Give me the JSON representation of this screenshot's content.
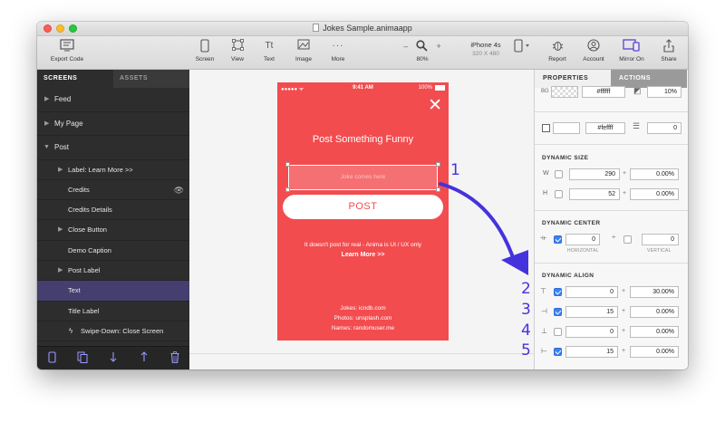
{
  "window": {
    "title": "Jokes Sample.animaapp"
  },
  "toolbar": {
    "export_label": "Export Code",
    "screen_label": "Screen",
    "view_label": "View",
    "text_label": "Text",
    "image_label": "Image",
    "more_label": "More",
    "zoom_value": "80%",
    "device_name": "iPhone 4s",
    "device_size": "320 X 480",
    "report_label": "Report",
    "account_label": "Account",
    "mirror_label": "Mirror On",
    "share_label": "Share",
    "text_icon_glyph": "Tt",
    "more_icon_glyph": "···",
    "zoom_out_glyph": "–",
    "zoom_in_glyph": "+",
    "accent_color": "#5b3fd6"
  },
  "sidebar": {
    "tab_screens": "SCREENS",
    "tab_assets": "ASSETS",
    "items": [
      {
        "label": "Feed"
      },
      {
        "label": "My Page"
      },
      {
        "label": "Post"
      },
      {
        "label": "Label: Learn More >>"
      },
      {
        "label": "Credits"
      },
      {
        "label": "Credits Details"
      },
      {
        "label": "Close Button"
      },
      {
        "label": "Demo Caption"
      },
      {
        "label": "Post Label"
      },
      {
        "label": "Text"
      },
      {
        "label": "Title Label"
      },
      {
        "label": "Swipe-Down: Close Screen"
      }
    ]
  },
  "phone": {
    "bg_color": "#f24c4f",
    "status_time": "9:41 AM",
    "status_battery": "100%",
    "status_signal": "●●●●● ᯤ",
    "title": "Post Something Funny",
    "joke_placeholder": "Joke comes here",
    "post_button": "POST",
    "note": "It doesn't post for real - Anima is UI / UX only",
    "learn_more": "Learn More >>",
    "credit_1": "Jokes: icndb.com",
    "credit_2": "Photos: unsplash.com",
    "credit_3": "Names: randomuser.me"
  },
  "panel": {
    "tab_properties": "PROPERTIES",
    "tab_actions": "ACTIONS",
    "bg_label": "BG",
    "bg_color_value": "#ffffff",
    "bg_opacity": "10%",
    "border_color_value": "#feffff",
    "border_width": "0",
    "dynamic_size": {
      "heading": "DYNAMIC SIZE",
      "w_label": "W",
      "w_value": "290",
      "w_percent": "0.00%",
      "h_label": "H",
      "h_value": "52",
      "h_percent": "0.00%"
    },
    "dynamic_center": {
      "heading": "DYNAMIC CENTER",
      "horizontal_value": "0",
      "horizontal_label": "HORIZONTAL",
      "vertical_value": "0",
      "vertical_label": "VERTICAL"
    },
    "dynamic_align": {
      "heading": "DYNAMIC ALIGN",
      "rows": [
        {
          "value": "0",
          "percent": "30.00%",
          "checked": true
        },
        {
          "value": "15",
          "percent": "0.00%",
          "checked": true
        },
        {
          "value": "0",
          "percent": "0.00%",
          "checked": false
        },
        {
          "value": "15",
          "percent": "0.00%",
          "checked": true
        }
      ]
    }
  },
  "annotations": [
    "1",
    "2",
    "3",
    "4",
    "5"
  ],
  "annotation_color": "#4433dd"
}
